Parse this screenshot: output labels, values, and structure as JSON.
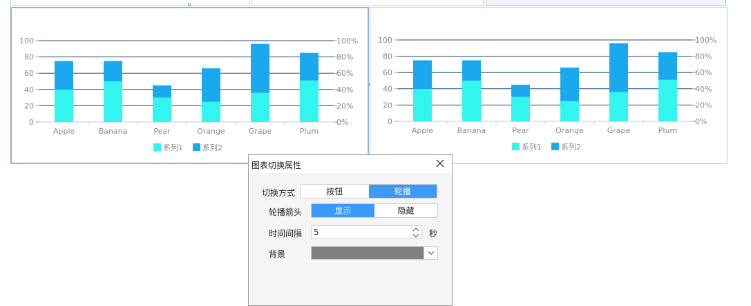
{
  "chart_data": [
    {
      "type": "bar",
      "stacked": true,
      "categories": [
        "Apple",
        "Banana",
        "Pear",
        "Orange",
        "Grape",
        "Plum"
      ],
      "series": [
        {
          "name": "系列1",
          "values": [
            40,
            50,
            30,
            25,
            36,
            51
          ]
        },
        {
          "name": "系列2",
          "values": [
            35,
            25,
            15,
            41,
            60,
            34
          ]
        }
      ],
      "y_left_ticks": [
        "0",
        "20",
        "40",
        "60",
        "80",
        "100"
      ],
      "y_right_ticks": [
        "0%",
        "20%",
        "40%",
        "60%",
        "80%",
        "100%"
      ],
      "ylim": [
        0,
        100
      ],
      "grid": true,
      "legend": "bottom",
      "colors": [
        "#33f5f0",
        "#1aa8ee"
      ]
    },
    {
      "type": "bar",
      "stacked": true,
      "categories": [
        "Apple",
        "Banana",
        "Pear",
        "Orange",
        "Grape",
        "Plum"
      ],
      "series": [
        {
          "name": "系列1",
          "values": [
            40,
            50,
            30,
            25,
            36,
            51
          ]
        },
        {
          "name": "系列2",
          "values": [
            35,
            25,
            15,
            41,
            60,
            34
          ]
        }
      ],
      "y_left_ticks": [
        "0",
        "20",
        "40",
        "60",
        "80",
        "100"
      ],
      "y_right_ticks": [
        "0%",
        "20%",
        "40%",
        "60%",
        "80%",
        "100%"
      ],
      "ylim": [
        0,
        100
      ],
      "grid": true,
      "legend": "bottom",
      "colors": [
        "#33f5f0",
        "#1aa8ee"
      ]
    }
  ],
  "dialog": {
    "title": "图表切换属性",
    "switch_mode": {
      "label": "切换方式",
      "options": [
        "按钮",
        "轮播"
      ],
      "selected": 1
    },
    "carousel_arrow": {
      "label": "轮播箭头",
      "options": [
        "显示",
        "隐藏"
      ],
      "selected": 0
    },
    "interval": {
      "label": "时间间隔",
      "value": "5",
      "unit": "秒"
    },
    "background": {
      "label": "背景",
      "color": "#808080"
    }
  }
}
